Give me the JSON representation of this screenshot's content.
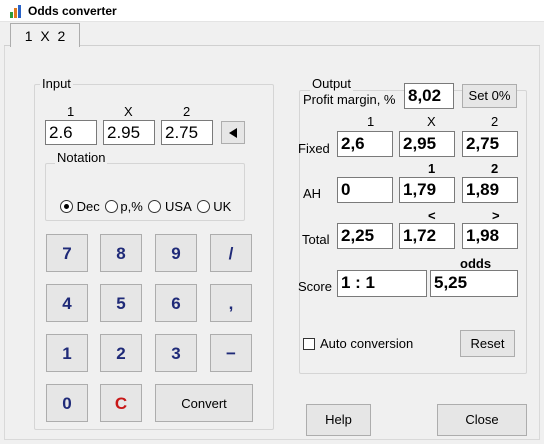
{
  "window": {
    "title": "Odds converter",
    "icon": "bar-chart-icon"
  },
  "tab": {
    "label": "1  X  2"
  },
  "input": {
    "group_label": "Input",
    "headers": [
      "1",
      "X",
      "2"
    ],
    "values": [
      "2.6",
      "2.95",
      "2.75"
    ],
    "arrow_icon": "left-arrow-icon",
    "notation": {
      "group_label": "Notation",
      "options": [
        "Dec",
        "p,%",
        "USA",
        "UK"
      ],
      "selected": "Dec"
    },
    "keypad": {
      "row1": [
        "7",
        "8",
        "9",
        "/"
      ],
      "row2": [
        "4",
        "5",
        "6",
        ","
      ],
      "row3": [
        "1",
        "2",
        "3",
        "−"
      ],
      "row4": [
        "0",
        "C"
      ],
      "convert_label": "Convert"
    }
  },
  "output": {
    "group_label": "Output",
    "profit_margin_label": "Profit margin, %",
    "profit_margin_value": "8,02",
    "set0_label": "Set 0%",
    "headers": [
      "1",
      "X",
      "2"
    ],
    "fixed": {
      "label": "Fixed",
      "values": [
        "2,6",
        "2,95",
        "2,75"
      ]
    },
    "ah": {
      "label": "AH",
      "values": [
        "0",
        "1,79",
        "1,89"
      ],
      "headers": [
        "1",
        "2"
      ]
    },
    "total": {
      "label": "Total",
      "values": [
        "2,25",
        "1,72",
        "1,98"
      ],
      "headers": [
        "<",
        ">"
      ]
    },
    "score": {
      "label": "Score",
      "value": "1 : 1",
      "odds_label": "odds",
      "odds_value": "5,25"
    },
    "auto_conversion_label": "Auto conversion",
    "reset_label": "Reset"
  },
  "footer": {
    "help_label": "Help",
    "close_label": "Close"
  },
  "colors": {
    "key_text": "#1f2a78",
    "clear_key": "#c81818",
    "icon_green": "#2e9d3a",
    "icon_orange": "#e07a1f",
    "icon_blue": "#2a63c8"
  }
}
